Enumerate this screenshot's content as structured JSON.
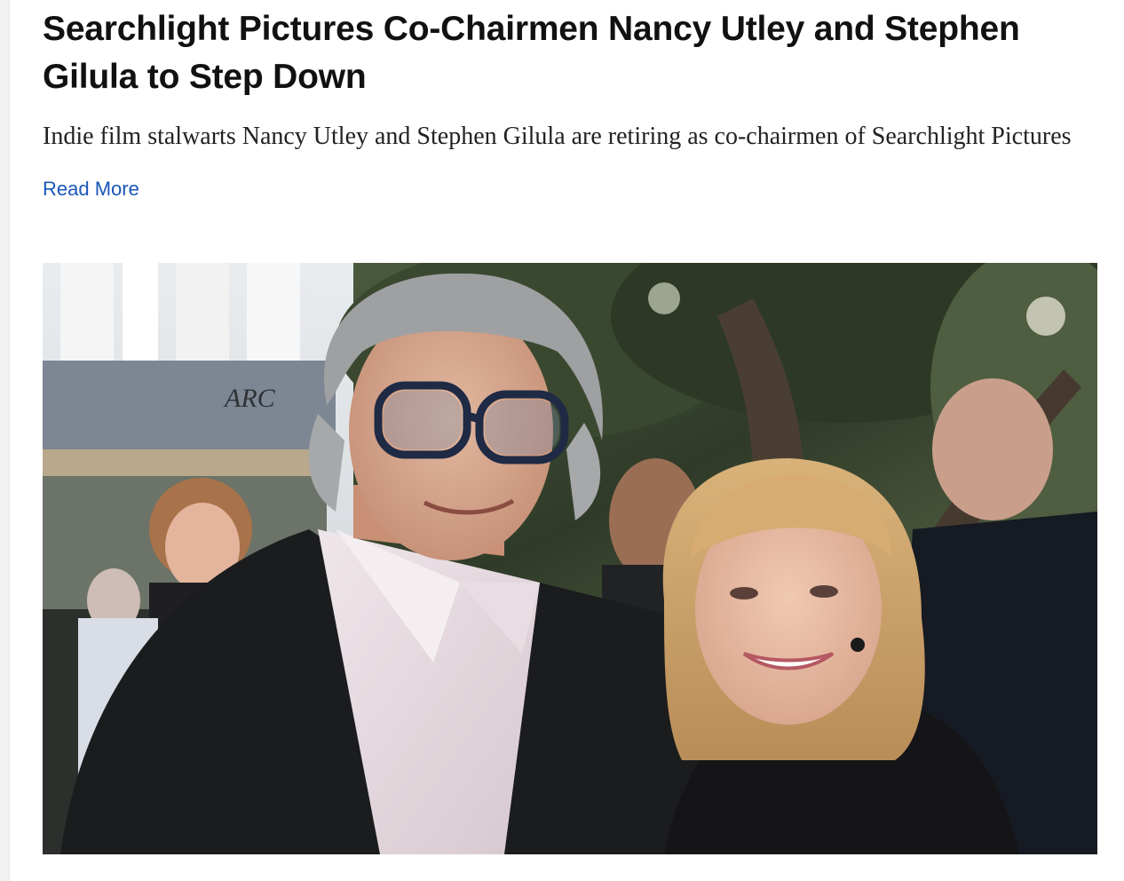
{
  "article": {
    "headline": "Searchlight Pictures Co-Chairmen Nancy Utley and Stephen Gilula to Step Down",
    "dek": "Indie film stalwarts Nancy Utley and Stephen Gilula are retiring as co-chairmen of Searchlight Pictures",
    "read_more_label": "Read More",
    "link_color": "#1a56b8"
  },
  "photo": {
    "storefront_sign": "ARC"
  }
}
